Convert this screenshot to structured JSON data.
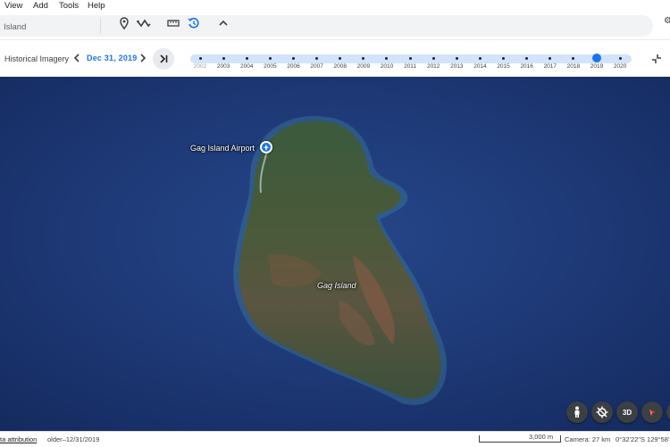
{
  "menu": {
    "items": [
      "View",
      "Add",
      "Tools",
      "Help"
    ]
  },
  "toolbar": {
    "search_value": "Island"
  },
  "history": {
    "label": "Historical Imagery",
    "date": "Dec 31, 2019",
    "years": [
      "2002",
      "2003",
      "2004",
      "2005",
      "2006",
      "2007",
      "2008",
      "2009",
      "2010",
      "2011",
      "2012",
      "2013",
      "2014",
      "2015",
      "2016",
      "2017",
      "2018",
      "2019",
      "2020"
    ],
    "selected_year": "2019",
    "disabled_year": "2002"
  },
  "map": {
    "airport_label": "Gag Island Airport",
    "island_label": "Gag Island",
    "btn_3d": "3D"
  },
  "status": {
    "attribution": "ta attribution",
    "imagery_date": "older–12/31/2019",
    "scale": "3,000 m",
    "camera": "Camera: 27 km",
    "coords": "0°32'22\"S 129°58'"
  },
  "colors": {
    "accent": "#1a73e8",
    "ocean": "#1f3a78",
    "timeline": "#d2e3fc"
  }
}
